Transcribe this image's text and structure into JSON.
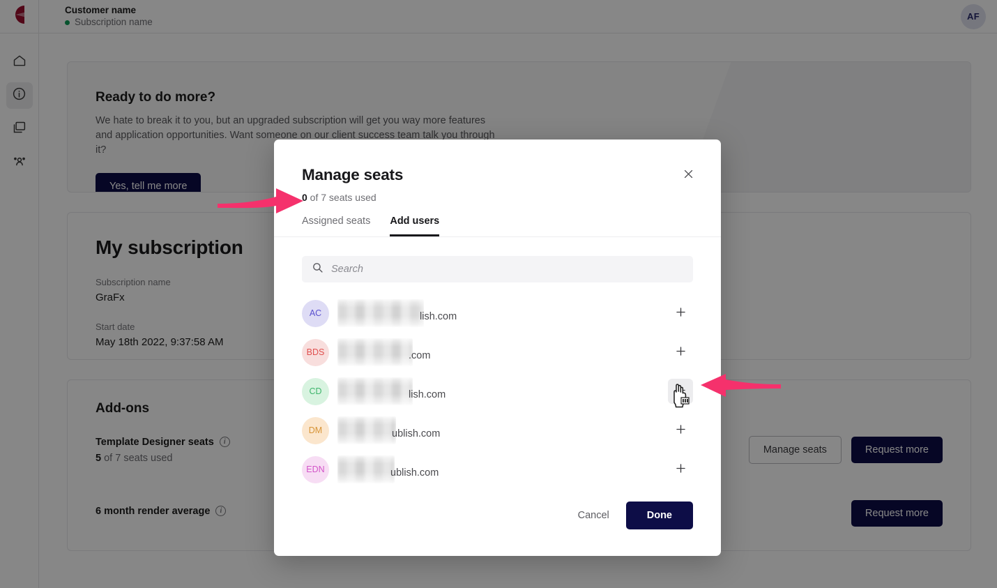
{
  "topbar": {
    "logo_icon": "grafx-logo-icon",
    "customer_name": "Customer name",
    "subscription_name": "Subscription name",
    "avatar_initials": "AF"
  },
  "sidebar": {
    "items": [
      {
        "icon": "home-icon",
        "name": "home",
        "active": false
      },
      {
        "icon": "info-icon",
        "name": "subscription",
        "active": true
      },
      {
        "icon": "windows-icon",
        "name": "environments",
        "active": false
      },
      {
        "icon": "users-icon",
        "name": "users",
        "active": false
      }
    ]
  },
  "promo": {
    "title": "Ready to do more?",
    "body": "We hate to break it to you, but an upgraded subscription will get you way more features and application opportunities. Want someone on our client success team talk you through it?",
    "cta_label": "Yes, tell me more"
  },
  "subscription": {
    "heading": "My subscription",
    "name_label": "Subscription name",
    "name_value": "GraFx",
    "start_label": "Start date",
    "start_value": "May 18th 2022, 9:37:58 AM"
  },
  "addons": {
    "heading": "Add-ons",
    "rows": [
      {
        "name": "Template Designer seats",
        "info_icon": "info-icon",
        "used": "5",
        "usage_rest": " of 7 seats used",
        "secondary_label": "Manage seats",
        "primary_label": "Request more"
      },
      {
        "name": "6 month render average",
        "info_icon": "info-icon",
        "used": "",
        "usage_rest": "",
        "secondary_label": "",
        "primary_label": "Request more"
      }
    ]
  },
  "modal": {
    "title": "Manage seats",
    "seats_used_count": "0",
    "seats_used_rest": " of 7 seats used",
    "close_icon": "close-icon",
    "tabs": [
      {
        "label": "Assigned seats",
        "active": false
      },
      {
        "label": "Add users",
        "active": true
      }
    ],
    "search": {
      "icon": "search-icon",
      "placeholder": "Search",
      "value": ""
    },
    "users": [
      {
        "initials": "AC",
        "domain": "lish.com",
        "bg": "#dedcf5",
        "fg": "#5b51cf",
        "add_icon": "plus-icon",
        "redact_width": 124,
        "hovered": false
      },
      {
        "initials": "BDS",
        "domain": ".com",
        "bg": "#f8dedd",
        "fg": "#e0504f",
        "add_icon": "plus-icon",
        "redact_width": 108,
        "hovered": false
      },
      {
        "initials": "CD",
        "domain": "lish.com",
        "bg": "#d8f3e0",
        "fg": "#3fb56c",
        "add_icon": "plus-icon",
        "redact_width": 108,
        "hovered": true
      },
      {
        "initials": "DM",
        "domain": "ublish.com",
        "bg": "#fbe6cd",
        "fg": "#d79437",
        "add_icon": "plus-icon",
        "redact_width": 84,
        "hovered": false
      },
      {
        "initials": "EDN",
        "domain": "ublish.com",
        "bg": "#f7ddf4",
        "fg": "#d355c9",
        "add_icon": "plus-icon",
        "redact_width": 82,
        "hovered": false
      }
    ],
    "cancel_label": "Cancel",
    "done_label": "Done"
  },
  "annotations": {
    "arrow_color": "#F5316C",
    "cursor_icon": "pointing-hand-cursor",
    "arrows": [
      {
        "name": "arrow-to-seats-counter",
        "direction": "right"
      },
      {
        "name": "arrow-to-add-button",
        "direction": "left"
      }
    ]
  },
  "colors": {
    "navy": "#0d0d47",
    "accent_pink": "#F5316C",
    "logo_red": "#9B0F2E",
    "status_green": "#0f9d58"
  }
}
